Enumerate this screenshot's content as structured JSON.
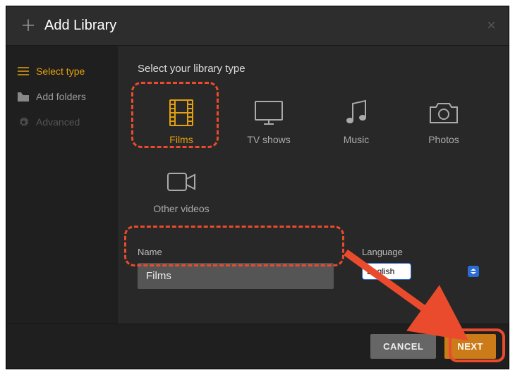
{
  "header": {
    "title": "Add Library",
    "close": "×"
  },
  "sidebar": {
    "items": [
      {
        "label": "Select type",
        "icon": "list-icon"
      },
      {
        "label": "Add folders",
        "icon": "folder-icon"
      },
      {
        "label": "Advanced",
        "icon": "gear-icon"
      }
    ]
  },
  "main": {
    "section_title": "Select your library type",
    "types": [
      {
        "label": "Films",
        "icon": "film-icon"
      },
      {
        "label": "TV shows",
        "icon": "tv-icon"
      },
      {
        "label": "Music",
        "icon": "music-icon"
      },
      {
        "label": "Photos",
        "icon": "camera-icon"
      },
      {
        "label": "Other videos",
        "icon": "video-icon"
      }
    ],
    "name_label": "Name",
    "name_value": "Films",
    "lang_label": "Language",
    "lang_value": "English"
  },
  "footer": {
    "cancel": "CANCEL",
    "next": "NEXT"
  }
}
